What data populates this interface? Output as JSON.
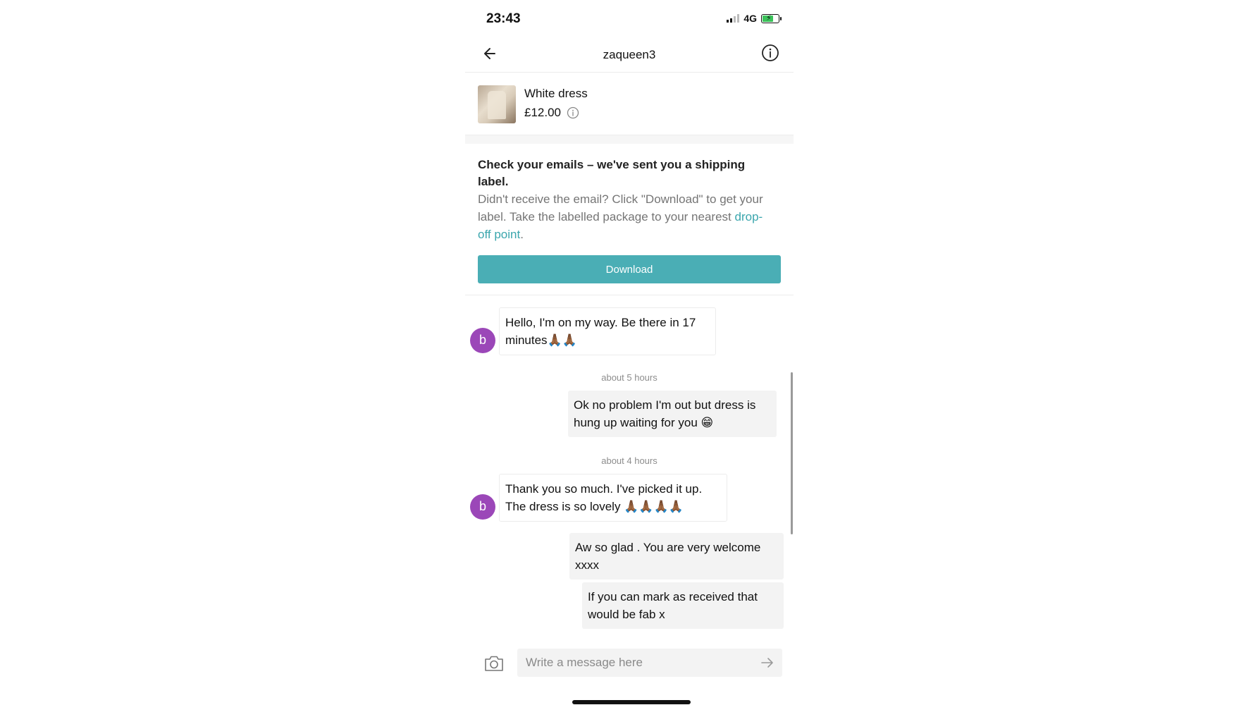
{
  "status_bar": {
    "time": "23:43",
    "network": "4G"
  },
  "header": {
    "title": "zaqueen3"
  },
  "item": {
    "name": "White dress",
    "price": "£12.00"
  },
  "shipping": {
    "title": "Check your emails – we've sent you a shipping label.",
    "body_prefix": "Didn't receive the email? Click \"Download\" to get your label. Take the labelled package to your nearest ",
    "link_text": "drop-off point",
    "body_suffix": ".",
    "download_label": "Download"
  },
  "messages": [
    {
      "from": "other",
      "avatar_letter": "b",
      "text": "Hello, I'm on my way. Be there in 17 minutes🙏🏾🙏🏾"
    },
    {
      "timestamp": "about 5 hours"
    },
    {
      "from": "me",
      "text": "Ok no problem I'm out but dress is hung up waiting for you 😁"
    },
    {
      "timestamp": "about 4 hours"
    },
    {
      "from": "other",
      "avatar_letter": "b",
      "text": "Thank you so much. I've picked it up. The dress is so lovely 🙏🏾🙏🏾🙏🏾🙏🏾"
    },
    {
      "from": "me",
      "text": "Aw so glad . You are very welcome xxxx"
    },
    {
      "from": "me",
      "text": "If you can mark as received that would be fab x"
    }
  ],
  "composer": {
    "placeholder": "Write a message here"
  },
  "icons": {
    "back": "arrow-left-icon",
    "info": "info-circle-icon",
    "camera": "camera-icon",
    "send": "arrow-right-icon"
  },
  "colors": {
    "accent": "#4aaeb5",
    "link": "#3aa6ad",
    "avatar": "#9b47b8"
  }
}
